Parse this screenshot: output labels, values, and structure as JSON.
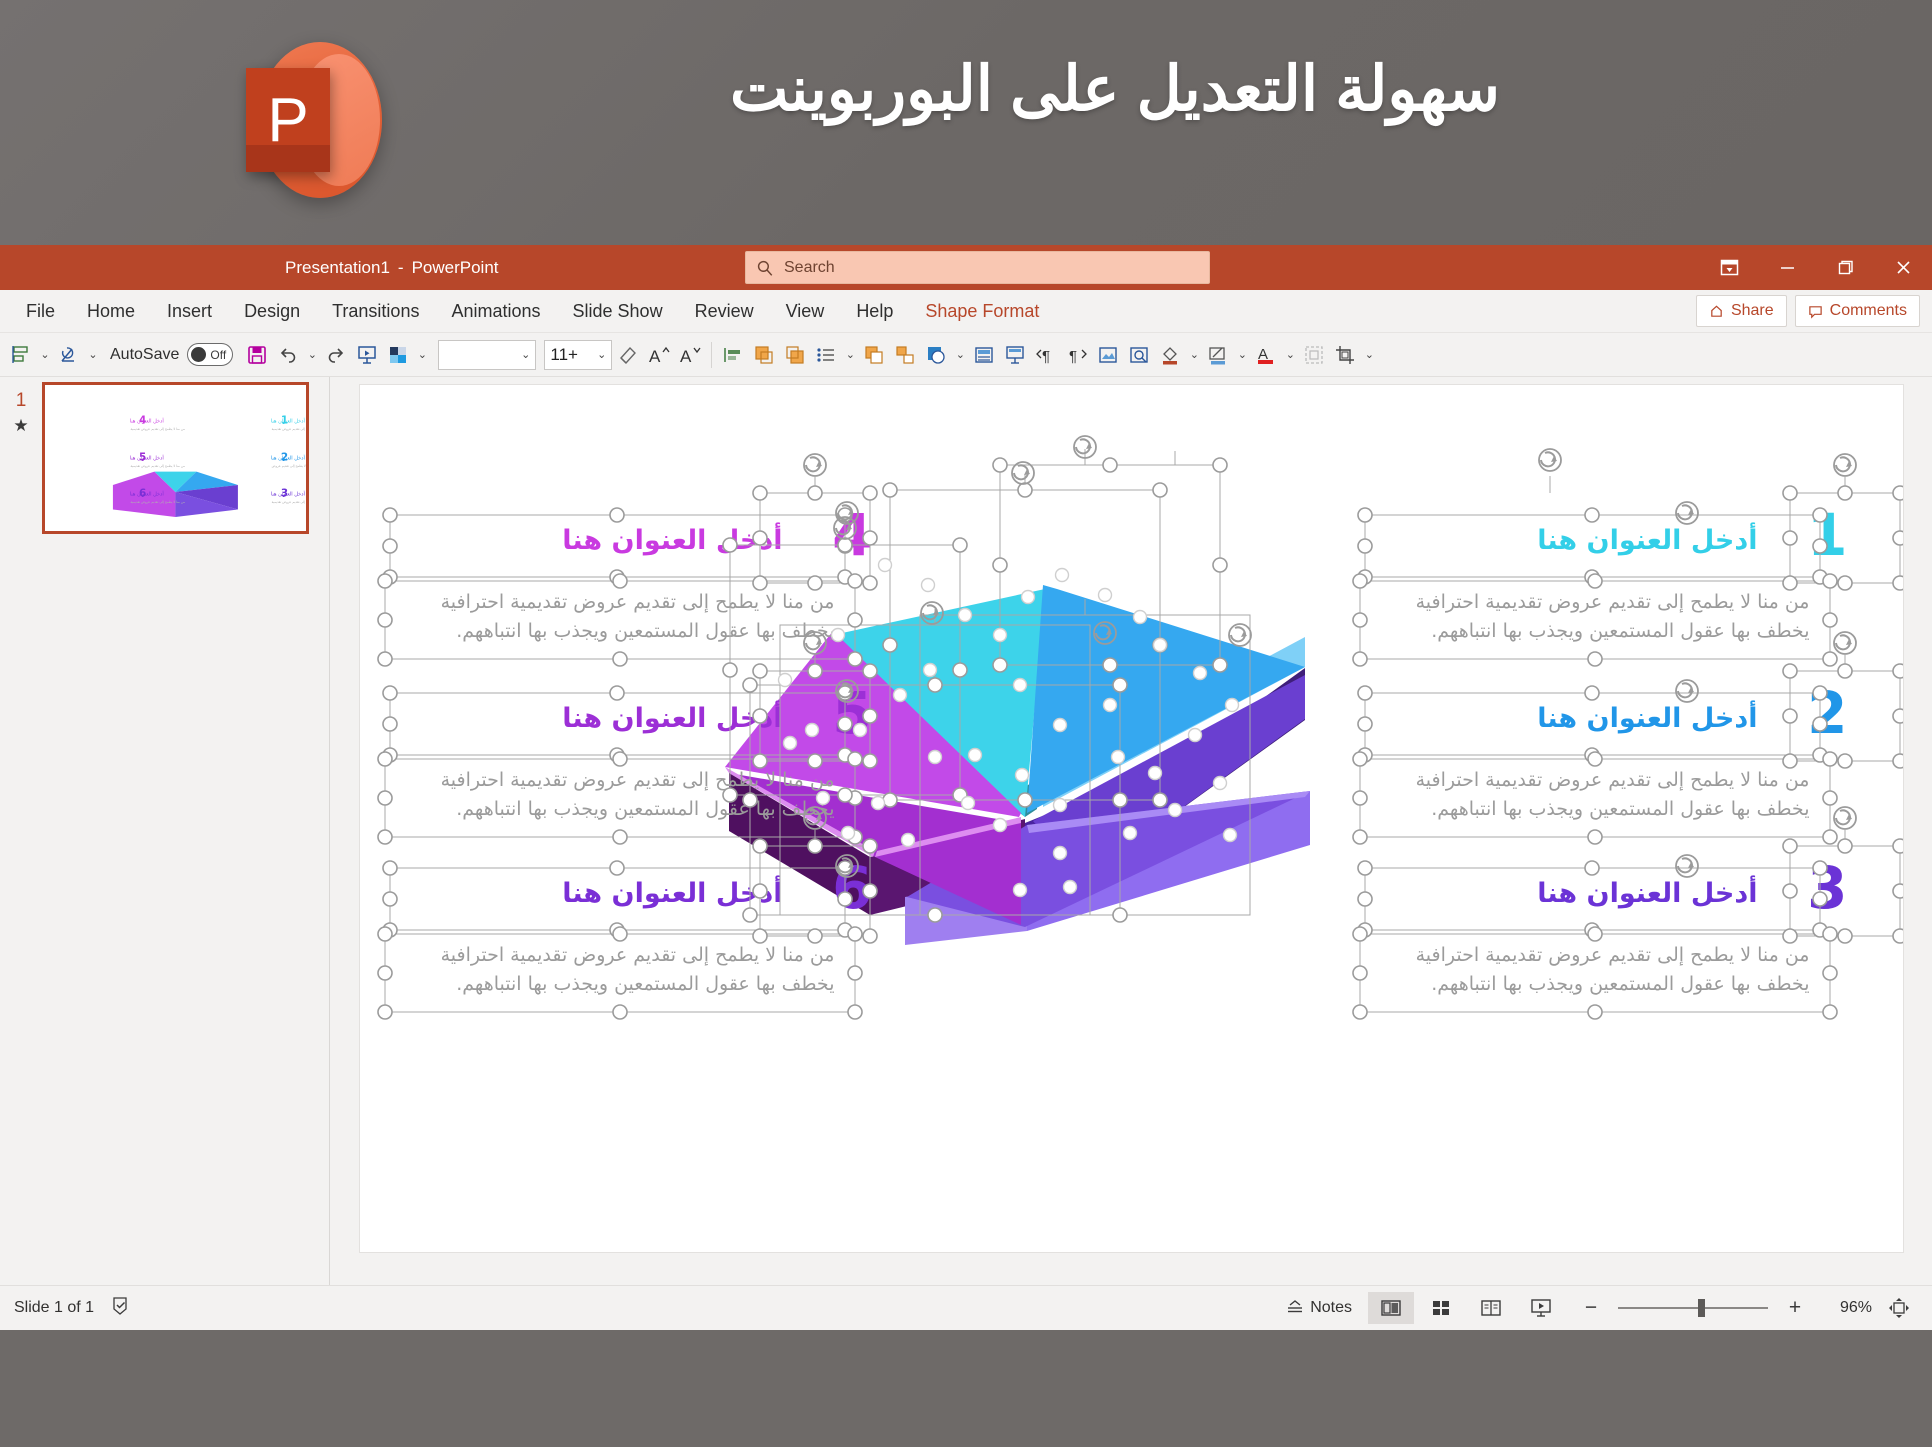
{
  "banner": {
    "title": "سهولة التعديل على البوربوينت",
    "logo_letter": "P",
    "logo_name": "powerpoint-logo"
  },
  "titlebar": {
    "document_name": "Presentation1",
    "separator": "-",
    "app_name": "PowerPoint",
    "search_placeholder": "Search",
    "ribbon_display_options": "Ribbon Display Options",
    "minimize": "Minimize",
    "restore": "Restore Down",
    "close": "Close"
  },
  "ribbon": {
    "tabs": [
      {
        "label": "File",
        "active": false
      },
      {
        "label": "Home",
        "active": false
      },
      {
        "label": "Insert",
        "active": false
      },
      {
        "label": "Design",
        "active": false
      },
      {
        "label": "Transitions",
        "active": false
      },
      {
        "label": "Animations",
        "active": false
      },
      {
        "label": "Slide Show",
        "active": false
      },
      {
        "label": "Review",
        "active": false
      },
      {
        "label": "View",
        "active": false
      },
      {
        "label": "Help",
        "active": false
      },
      {
        "label": "Shape Format",
        "active": true
      }
    ],
    "share_label": "Share",
    "comments_label": "Comments"
  },
  "toolbar": {
    "autosave_label": "AutoSave",
    "autosave_state": "Off",
    "font_name": "",
    "font_size": "11+",
    "accent_color": "#b7472a"
  },
  "thumbnails": {
    "items": [
      {
        "number": "1",
        "selected": true,
        "has_animation": true
      }
    ]
  },
  "slide": {
    "title_placeholder": "أدخل العنوان هنا",
    "body_placeholder": "من منا لا يطمح إلى تقديم عروض تقديمية احترافية يخطف بها عقول المستمعين ويجذب بها انتباههم.",
    "items": [
      {
        "number": "1",
        "color": "#33cfe8",
        "side": "right",
        "title": "أدخل العنوان هنا",
        "body": "من منا لا يطمح إلى تقديم عروض تقديمية احترافية يخطف بها عقول المستمعين ويجذب بها انتباههم."
      },
      {
        "number": "2",
        "color": "#2196e8",
        "side": "right",
        "title": "أدخل العنوان هنا",
        "body": "من منا لا يطمح إلى تقديم عروض تقديمية احترافية يخطف بها عقول المستمعين ويجذب بها انتباههم."
      },
      {
        "number": "3",
        "color": "#6b33d6",
        "side": "right",
        "title": "أدخل العنوان هنا",
        "body": "من منا لا يطمح إلى تقديم عروض تقديمية احترافية يخطف بها عقول المستمعين ويجذب بها انتباههم."
      },
      {
        "number": "4",
        "color": "#c93ae0",
        "side": "left",
        "title": "أدخل العنوان هنا",
        "body": "من منا لا يطمح إلى تقديم عروض تقديمية احترافية يخطف بها عقول المستمعين ويجذب بها انتباههم."
      },
      {
        "number": "5",
        "color": "#9c2fd6",
        "side": "left",
        "title": "أدخل العنوان هنا",
        "body": "من منا لا يطمح إلى تقديم عروض تقديمية احترافية يخطف بها عقول المستمعين ويجذب بها انتباههم."
      },
      {
        "number": "6",
        "color": "#7a2fd6",
        "side": "left",
        "title": "أدخل العنوان هنا",
        "body": "من منا لا يطمح إلى تقديم عروض تقديمية احترافية يخطف بها عقول المستمعين ويجذب بها انتباههم."
      }
    ],
    "diagram": {
      "name": "3d-hexagon-pie-diagram",
      "segments": [
        {
          "id": "seg-1",
          "top": "#3dd3ea",
          "side": "#2a9fae",
          "label": "1"
        },
        {
          "id": "seg-2",
          "top": "#35a8f0",
          "side": "#7fd0f7",
          "label": "2"
        },
        {
          "id": "seg-3",
          "top": "#6a3fd0",
          "side": "#3f1f7a",
          "label": "3"
        },
        {
          "id": "seg-4",
          "top": "#7a4fe0",
          "side": "#9f7ff0",
          "label": "4"
        },
        {
          "id": "seg-5",
          "top": "#a32fd0",
          "side": "#4f1060",
          "label": "5"
        },
        {
          "id": "seg-6",
          "top": "#c24ae8",
          "side": "#dd8df0",
          "label": "6"
        }
      ]
    }
  },
  "statusbar": {
    "slide_indicator": "Slide 1 of 1",
    "accessibility_icon": "accessibility-checker-icon",
    "notes_label": "Notes",
    "views": [
      {
        "name": "normal-view",
        "active": true
      },
      {
        "name": "slide-sorter-view",
        "active": false
      },
      {
        "name": "reading-view",
        "active": false
      },
      {
        "name": "slide-show-view",
        "active": false
      }
    ],
    "zoom_out": "−",
    "zoom_in": "+",
    "zoom_level": "96%",
    "fit_to_window": "Fit slide to current window"
  }
}
